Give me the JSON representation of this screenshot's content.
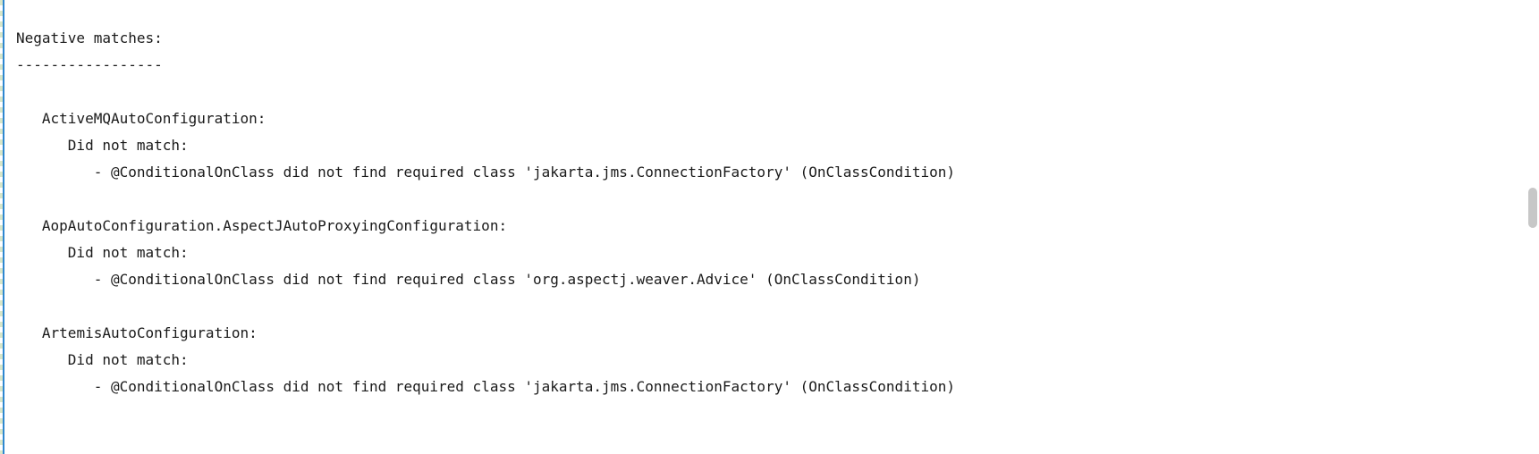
{
  "header": {
    "title": "Negative matches:",
    "divider": "-----------------"
  },
  "entries": [
    {
      "name": "ActiveMQAutoConfiguration:",
      "subhead": "Did not match:",
      "detail": "- @ConditionalOnClass did not find required class 'jakarta.jms.ConnectionFactory' (OnClassCondition)"
    },
    {
      "name": "AopAutoConfiguration.AspectJAutoProxyingConfiguration:",
      "subhead": "Did not match:",
      "detail": "- @ConditionalOnClass did not find required class 'org.aspectj.weaver.Advice' (OnClassCondition)"
    },
    {
      "name": "ArtemisAutoConfiguration:",
      "subhead": "Did not match:",
      "detail": "- @ConditionalOnClass did not find required class 'jakarta.jms.ConnectionFactory' (OnClassCondition)"
    }
  ]
}
